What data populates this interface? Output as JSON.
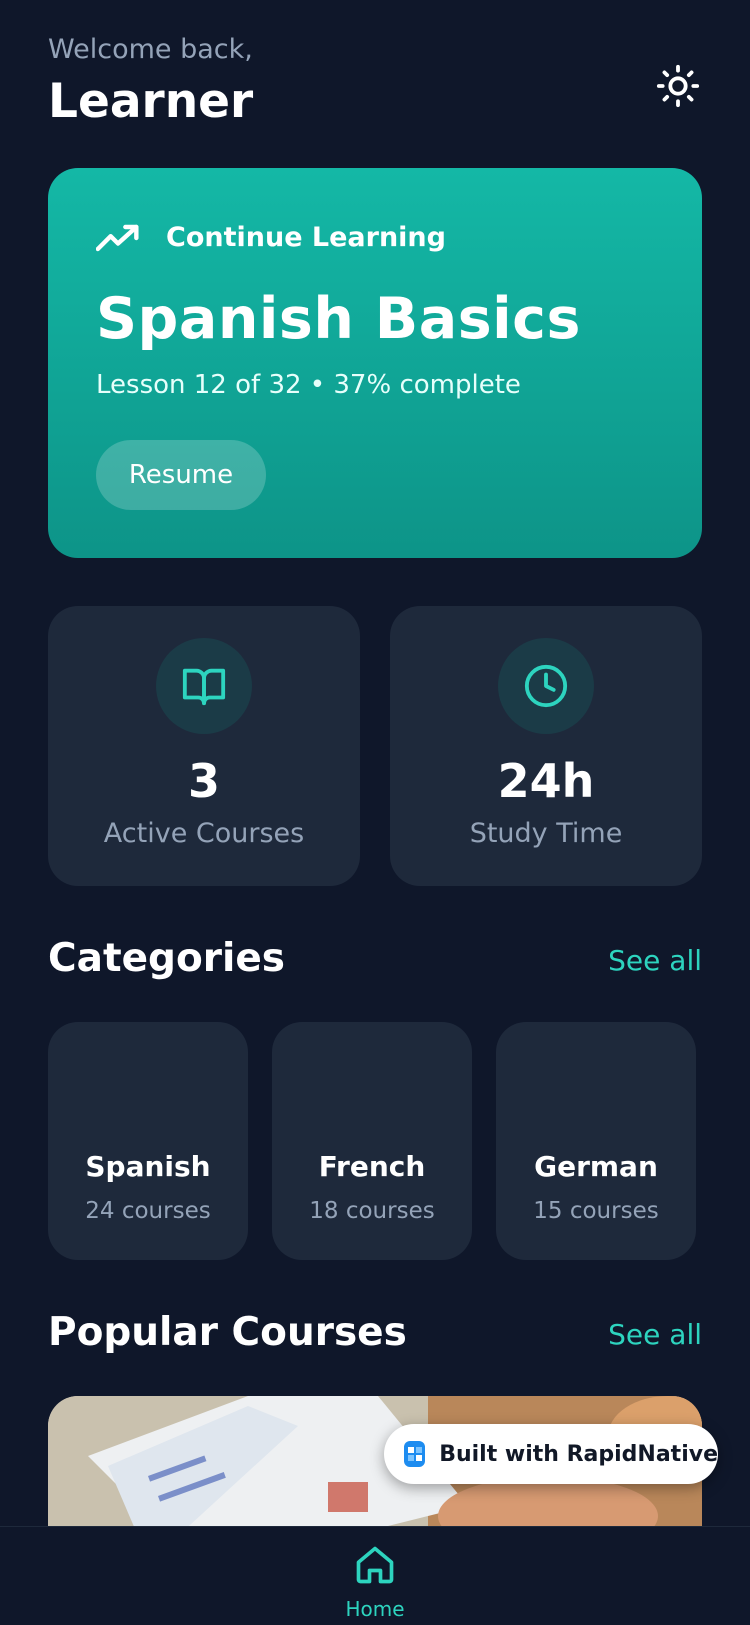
{
  "header": {
    "welcome": "Welcome back,",
    "name": "Learner",
    "theme_toggle_icon": "sun-icon"
  },
  "hero": {
    "kicker": "Continue Learning",
    "kicker_icon": "trending-up-icon",
    "title": "Spanish Basics",
    "subtitle": "Lesson 12 of 32 • 37% complete",
    "progress_percent": 37,
    "button_label": "Resume"
  },
  "stats": [
    {
      "icon": "book-open-icon",
      "value": "3",
      "label": "Active Courses"
    },
    {
      "icon": "clock-icon",
      "value": "24h",
      "label": "Study Time"
    }
  ],
  "categories": {
    "title": "Categories",
    "see_all": "See all",
    "items": [
      {
        "name": "Spanish",
        "count": "24 courses"
      },
      {
        "name": "French",
        "count": "18 courses"
      },
      {
        "name": "German",
        "count": "15 courses"
      }
    ]
  },
  "popular": {
    "title": "Popular Courses",
    "see_all": "See all"
  },
  "badge": {
    "text": "Built with RapidNative"
  },
  "nav": {
    "home_label": "Home",
    "home_icon": "home-icon"
  },
  "colors": {
    "background": "#0f172a",
    "card": "#1e293b",
    "accent": "#14b8a6",
    "accent_text": "#2dd4bf"
  }
}
